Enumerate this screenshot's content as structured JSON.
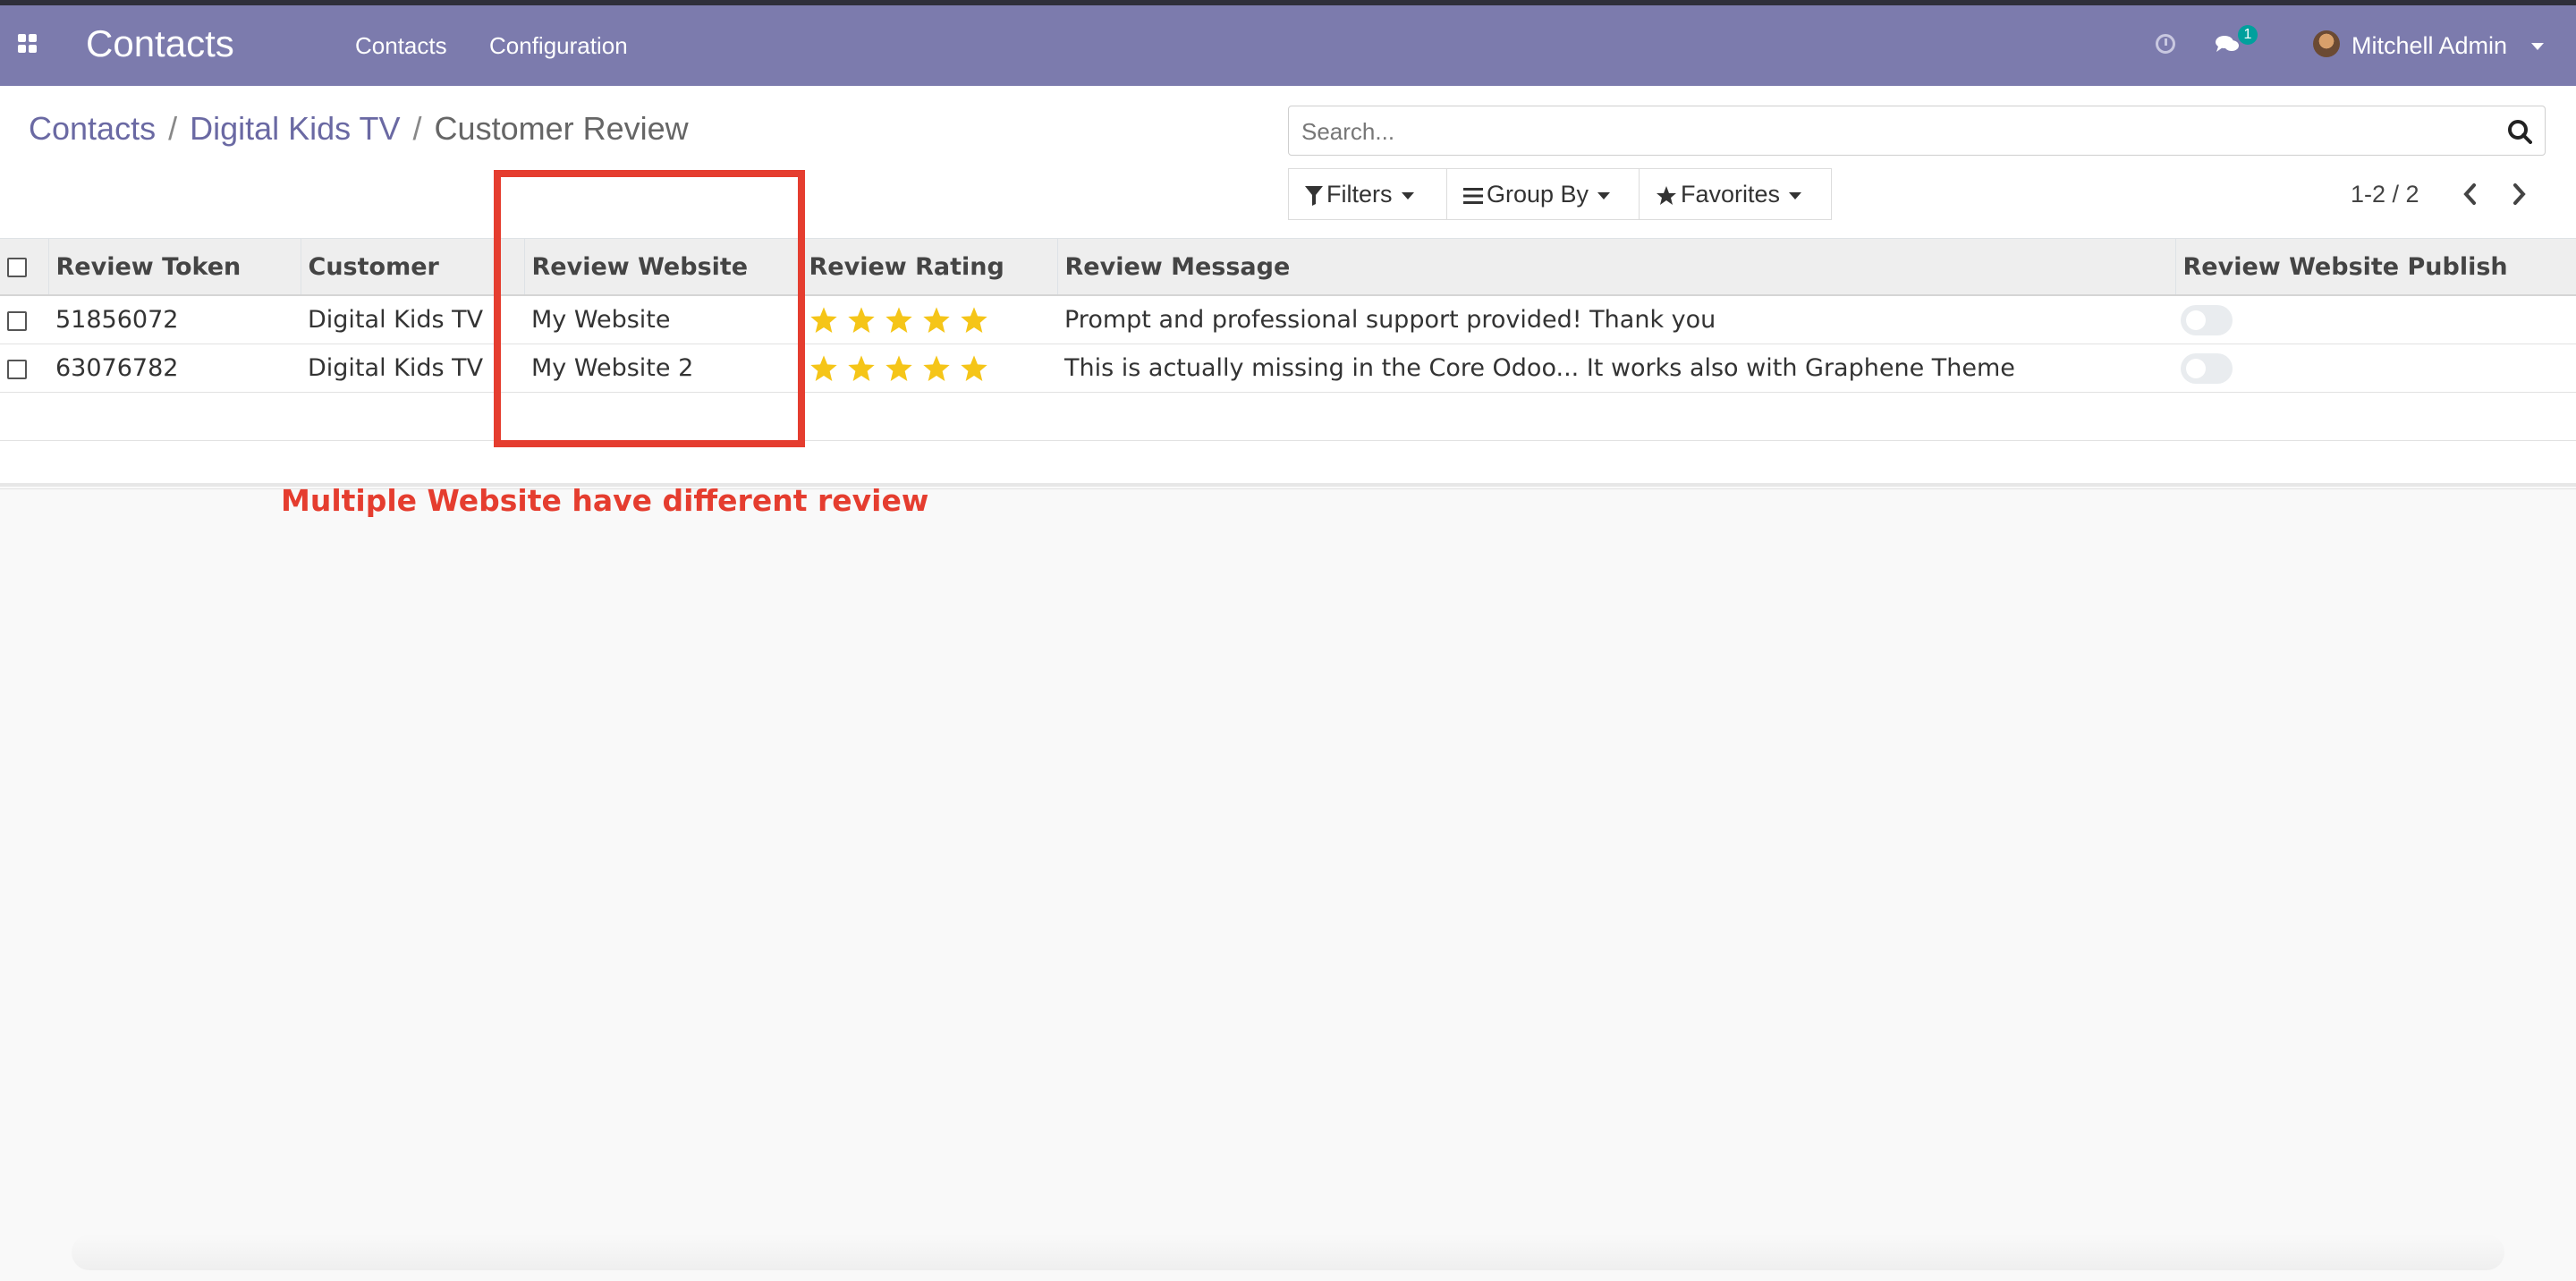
{
  "navbar": {
    "app_title": "Contacts",
    "menu": [
      "Contacts",
      "Configuration"
    ],
    "chat_badge": "1",
    "user_name": "Mitchell Admin"
  },
  "breadcrumb": [
    "Contacts",
    "Digital Kids TV",
    "Customer Review"
  ],
  "search": {
    "placeholder": "Search..."
  },
  "filters": {
    "filters_label": "Filters",
    "groupby_label": "Group By",
    "favorites_label": "Favorites"
  },
  "pager": {
    "value": "1-2 / 2"
  },
  "table": {
    "columns": [
      "Review Token",
      "Customer",
      "Review Website",
      "Review Rating",
      "Review Message",
      "Review Website Publish"
    ],
    "rows": [
      {
        "token": "51856072",
        "customer": "Digital Kids TV",
        "website": "My Website",
        "rating": 5,
        "message": "Prompt and professional support provided! Thank you",
        "published": false
      },
      {
        "token": "63076782",
        "customer": "Digital Kids TV",
        "website": "My Website 2",
        "rating": 5,
        "message": "This is actually missing in the Core Odoo... It works also with Graphene Theme",
        "published": false
      }
    ]
  },
  "annotation": {
    "text": "Multiple Website have different review",
    "color": "#e53d2f"
  },
  "colors": {
    "navbar": "#7c7bad",
    "star": "#f5c518",
    "link": "#6a69a3"
  }
}
